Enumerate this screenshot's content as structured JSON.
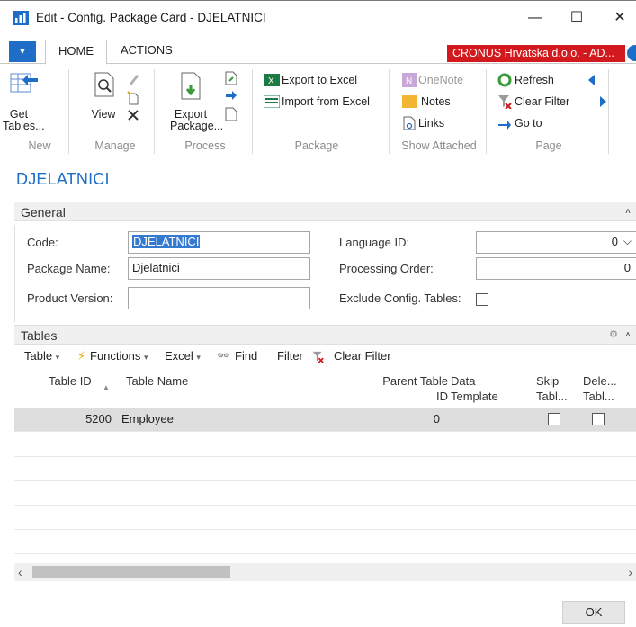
{
  "window": {
    "title": "Edit - Config. Package Card - DJELATNICI",
    "minimize": "—",
    "maximize": "☐",
    "close": "✕"
  },
  "ribbon_tabs": {
    "home": "HOME",
    "actions": "ACTIONS",
    "company": "CRONUS Hrvatska d.o.o. - AD..."
  },
  "ribbon": {
    "new": {
      "label": "New",
      "get_tables": [
        "Get",
        "Tables..."
      ]
    },
    "manage": {
      "label": "Manage",
      "view": "View"
    },
    "process": {
      "label": "Process",
      "export_package": [
        "Export",
        "Package..."
      ]
    },
    "package": {
      "label": "Package",
      "export_excel": "Export to Excel",
      "import_excel": "Import from Excel"
    },
    "show_attached": {
      "label": "Show Attached",
      "onenote": "OneNote",
      "notes": "Notes",
      "links": "Links"
    },
    "page": {
      "label": "Page",
      "refresh": "Refresh",
      "clear_filter": "Clear Filter",
      "go_to": "Go to"
    }
  },
  "page_title": "DJELATNICI",
  "general": {
    "title": "General",
    "code_label": "Code:",
    "code_value": "DJELATNICI",
    "package_name_label": "Package Name:",
    "package_name_value": "Djelatnici",
    "product_version_label": "Product Version:",
    "product_version_value": "",
    "language_id_label": "Language ID:",
    "language_id_value": "0",
    "processing_order_label": "Processing Order:",
    "processing_order_value": "0",
    "exclude_config_label": "Exclude Config. Tables:",
    "exclude_config_checked": false
  },
  "tables": {
    "title": "Tables",
    "toolbar": {
      "table": "Table",
      "functions": "Functions",
      "excel": "Excel",
      "find": "Find",
      "filter": "Filter",
      "clear_filter": "Clear Filter"
    },
    "columns": {
      "table_id": "Table ID",
      "table_name": "Table Name",
      "parent_table_id_1": "Parent Table",
      "parent_table_id_2": "ID",
      "data_template_1": "Data",
      "data_template_2": "Template",
      "skip_1": "Skip",
      "skip_2": "Tabl...",
      "delete_1": "Dele...",
      "delete_2": "Tabl..."
    },
    "rows": [
      {
        "table_id": "5200",
        "table_name": "Employee",
        "parent_table_id": "0",
        "data_template": "",
        "skip": false,
        "delete": false
      }
    ]
  },
  "ok_label": "OK",
  "colors": {
    "accent": "#1e6ec7",
    "company_banner": "#d2191d"
  }
}
